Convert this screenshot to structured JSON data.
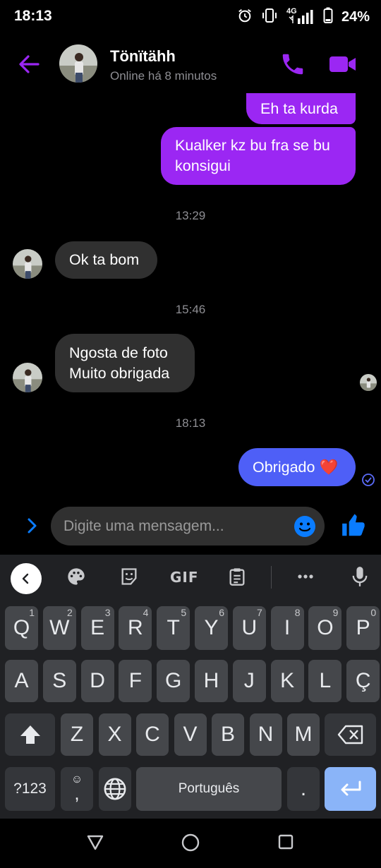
{
  "status_bar": {
    "time": "18:13",
    "network": "4G",
    "battery": "24%"
  },
  "header": {
    "contact_name": "Tönïtähh",
    "status": "Online há 8 minutos"
  },
  "messages": {
    "out_1": "Eh ta kurda",
    "out_2_line1": "Kualker kz bu fra se bu",
    "out_2_line2": "konsigui",
    "ts_1": "13:29",
    "in_1": "Ok ta bom",
    "ts_2": "15:46",
    "in_2_line1": "Ngosta de foto",
    "in_2_line2": "Muito obrigada",
    "ts_3": "18:13",
    "out_3": "Obrigado",
    "out_3_emoji": "❤️"
  },
  "composer": {
    "placeholder": "Digite uma mensagem..."
  },
  "keyboard": {
    "toolbar_gif": "GIF",
    "row1": [
      {
        "k": "Q",
        "h": "1"
      },
      {
        "k": "W",
        "h": "2"
      },
      {
        "k": "E",
        "h": "3"
      },
      {
        "k": "R",
        "h": "4"
      },
      {
        "k": "T",
        "h": "5"
      },
      {
        "k": "Y",
        "h": "6"
      },
      {
        "k": "U",
        "h": "7"
      },
      {
        "k": "I",
        "h": "8"
      },
      {
        "k": "O",
        "h": "9"
      },
      {
        "k": "P",
        "h": "0"
      }
    ],
    "row2": [
      "A",
      "S",
      "D",
      "F",
      "G",
      "H",
      "J",
      "K",
      "L",
      "Ç"
    ],
    "row3": [
      "Z",
      "X",
      "C",
      "V",
      "B",
      "N",
      "M"
    ],
    "symbols_key": "?123",
    "comma_key": ",",
    "space_label": "Português",
    "period_key": "."
  },
  "colors": {
    "accent_purple": "#9b27f3",
    "outgoing_blue": "#4e5ff7",
    "incoming_gray": "#303030",
    "messenger_blue": "#0a7cff"
  },
  "icons": {
    "back": "arrow-left-icon",
    "call": "phone-icon",
    "video": "video-camera-icon",
    "expand": "chevron-right-icon",
    "emoji": "smiley-icon",
    "like": "thumbs-up-icon",
    "palette": "palette-icon",
    "sticker": "sticker-icon",
    "clipboard": "clipboard-icon",
    "more": "more-icon",
    "mic": "microphone-icon",
    "shift": "shift-icon",
    "backspace": "backspace-icon",
    "globe": "globe-icon",
    "enter": "enter-icon"
  }
}
